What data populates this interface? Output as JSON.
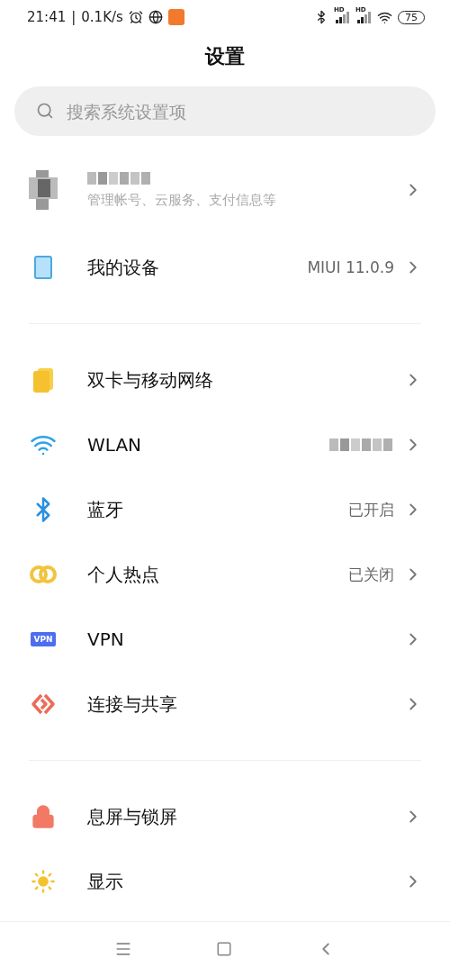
{
  "status_bar": {
    "time": "21:41",
    "separator": "|",
    "speed": "0.1K/s",
    "signals": [
      {
        "badge": "HD"
      },
      {
        "badge": "HD"
      }
    ],
    "battery": "75"
  },
  "title": "设置",
  "search": {
    "placeholder": "搜索系统设置项"
  },
  "sections": [
    [
      {
        "kind": "account",
        "subtitle": "管理帐号、云服务、支付信息等"
      },
      {
        "kind": "device",
        "label": "我的设备",
        "value": "MIUI 11.0.9"
      }
    ],
    [
      {
        "kind": "sim",
        "label": "双卡与移动网络"
      },
      {
        "kind": "wifi",
        "label": "WLAN",
        "value_hidden": true
      },
      {
        "kind": "bluetooth",
        "label": "蓝牙",
        "value": "已开启"
      },
      {
        "kind": "hotspot",
        "label": "个人热点",
        "value": "已关闭"
      },
      {
        "kind": "vpn",
        "label": "VPN",
        "badge": "VPN"
      },
      {
        "kind": "share",
        "label": "连接与共享"
      }
    ],
    [
      {
        "kind": "lock",
        "label": "息屏与锁屏"
      },
      {
        "kind": "display",
        "label": "显示"
      }
    ]
  ],
  "nav_bar": [
    {
      "kind": "menu"
    },
    {
      "kind": "home"
    },
    {
      "kind": "back"
    }
  ]
}
